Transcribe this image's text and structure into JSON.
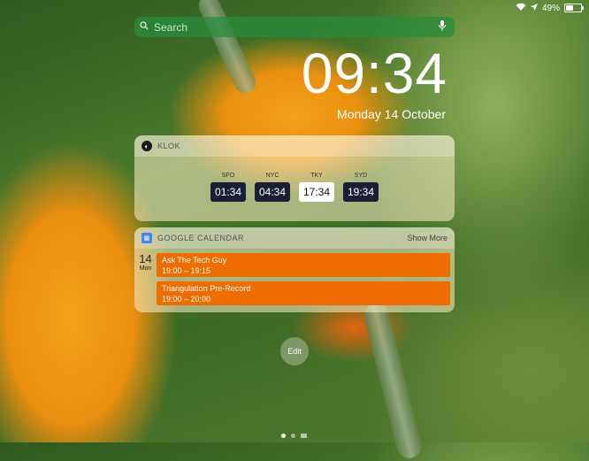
{
  "status_bar": {
    "battery_text": "49%",
    "battery_level": 0.49
  },
  "search": {
    "placeholder": "Search"
  },
  "lock": {
    "time": "09:34",
    "date": "Monday 14 October"
  },
  "klok": {
    "title": "KLOK",
    "clocks": [
      {
        "city": "SFO",
        "time": "01:34"
      },
      {
        "city": "NYC",
        "time": "04:34"
      },
      {
        "city": "TKY",
        "time": "17:34"
      },
      {
        "city": "SYD",
        "time": "19:34"
      }
    ]
  },
  "gcal": {
    "title": "GOOGLE CALENDAR",
    "show_more": "Show More",
    "day_num": "14",
    "day_name": "Mon",
    "events": [
      {
        "name": "Ask The Tech Guy",
        "time": "19:00 – 19:15"
      },
      {
        "name": "Triangulation Pre-Record",
        "time": "19:00 – 20:00"
      }
    ]
  },
  "edit_label": "Edit",
  "colors": {
    "event": "#ef6c00",
    "clock_dark": "#1b1f33"
  }
}
